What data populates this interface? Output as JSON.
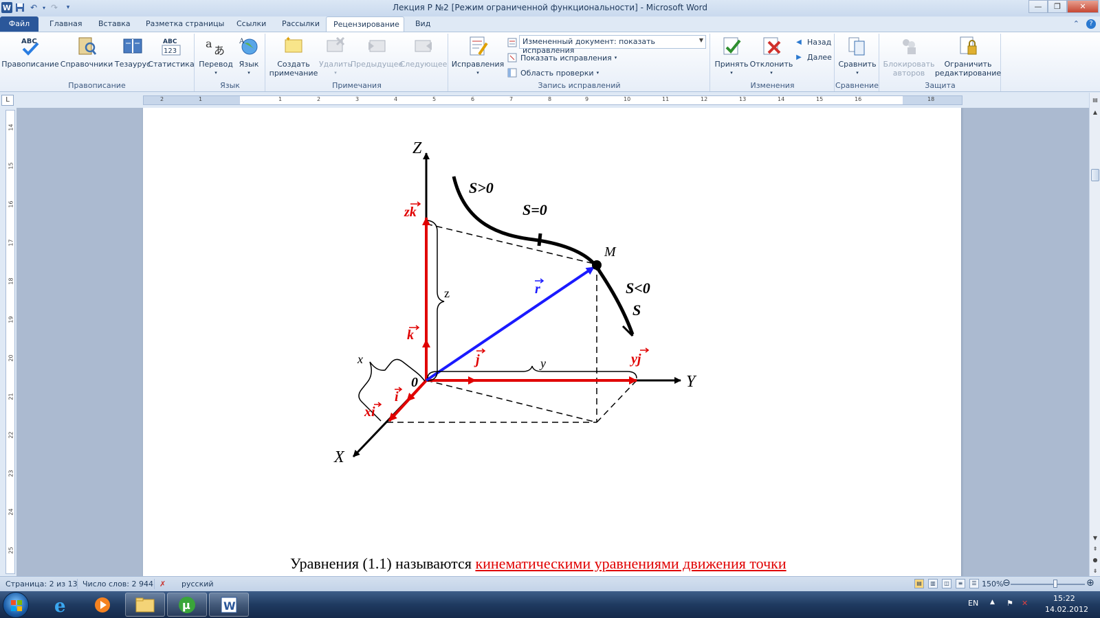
{
  "window": {
    "title": "Лекция Р №2 [Режим ограниченной функциональности]  -  Microsoft Word",
    "minimize": "—",
    "restore": "❐",
    "close": "✕"
  },
  "tabs": [
    {
      "label": "Файл"
    },
    {
      "label": "Главная"
    },
    {
      "label": "Вставка"
    },
    {
      "label": "Разметка страницы"
    },
    {
      "label": "Ссылки"
    },
    {
      "label": "Рассылки"
    },
    {
      "label": "Рецензирование"
    },
    {
      "label": "Вид"
    }
  ],
  "ribbon": {
    "groups": {
      "spelling": {
        "label": "Правописание",
        "buttons": [
          "Правописание",
          "Справочники",
          "Тезаурус",
          "Статистика"
        ]
      },
      "language": {
        "label": "Язык",
        "buttons": [
          "Перевод",
          "Язык"
        ]
      },
      "comments": {
        "label": "Примечания",
        "create_line1": "Создать",
        "create_line2": "примечание",
        "delete": "Удалить",
        "previous": "Предыдущее",
        "next": "Следующее"
      },
      "tracking": {
        "label": "Запись исправлений",
        "button": "Исправления",
        "combo": "Измененный документ: показать исправления",
        "show_markup": "Показать исправления",
        "review_pane": "Область проверки"
      },
      "changes": {
        "label": "Изменения",
        "accept": "Принять",
        "reject": "Отклонить",
        "back": "Назад",
        "forward": "Далее"
      },
      "compare": {
        "label": "Сравнение",
        "button": "Сравнить"
      },
      "protect": {
        "label": "Защита",
        "block_line1": "Блокировать",
        "block_line2": "авторов",
        "restrict_line1": "Ограничить",
        "restrict_line2": "редактирование"
      }
    }
  },
  "ruler": {
    "h_numbers": [
      "2",
      "1",
      "1",
      "2",
      "3",
      "4",
      "5",
      "6",
      "7",
      "8",
      "9",
      "10",
      "11",
      "12",
      "13",
      "14",
      "15",
      "16",
      "18"
    ],
    "v_numbers": [
      "14",
      "15",
      "16",
      "17",
      "18",
      "19",
      "20",
      "21",
      "22",
      "23",
      "24",
      "25"
    ]
  },
  "figure": {
    "axis_z": "Z",
    "axis_y": "Y",
    "axis_x": "X",
    "origin": "0",
    "label_zk": "zk",
    "label_k": "k",
    "label_j": "j",
    "label_yj": "yj",
    "label_i": "i",
    "label_xi": "xi",
    "label_r": "r",
    "label_z": "z",
    "label_y": "y",
    "label_x": "x",
    "point_m": "M",
    "s_pos": "S>0",
    "s_zero": "S=0",
    "s_neg": "S<0",
    "s": "S",
    "colors": {
      "red": "#e00000",
      "blue": "#1a1aff",
      "black": "#000000"
    }
  },
  "body_text": {
    "normal": "Уравнения (1.1) называются ",
    "highlight": "кинематическими уравнениями движения точки"
  },
  "status": {
    "page": "Страница: 2 из 13",
    "words": "Число слов: 2 944",
    "language": "русский",
    "zoom": "150%",
    "zoom_level": 0.5
  },
  "taskbar": {
    "lang": "EN",
    "time": "15:22",
    "date": "14.02.2012"
  }
}
